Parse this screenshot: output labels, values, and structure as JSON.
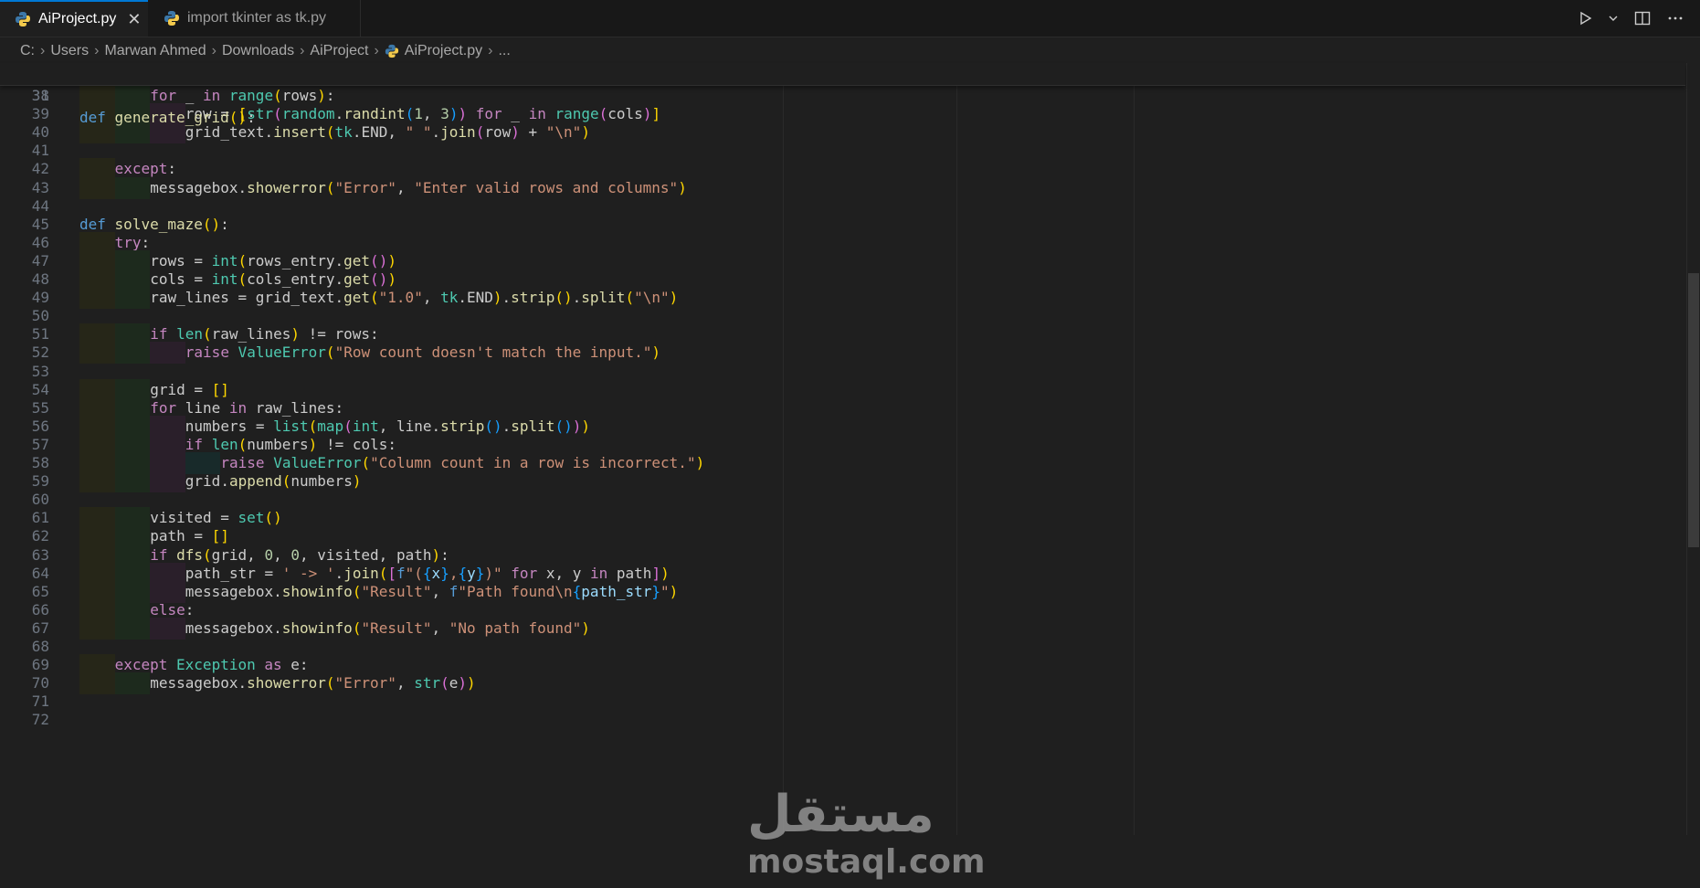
{
  "tabs": [
    {
      "label": "AiProject.py",
      "active": true
    },
    {
      "label": "import tkinter as tk.py",
      "active": false
    }
  ],
  "tab_close_glyph": "✕",
  "breadcrumb": [
    "C:",
    "Users",
    "Marwan Ahmed",
    "Downloads",
    "AiProject",
    "AiProject.py",
    "..."
  ],
  "sticky_line": {
    "num": "31",
    "code": "def generate_grid():"
  },
  "watermark": {
    "arabic": "مستقل",
    "latin": "mostaql.com"
  },
  "icons": {
    "run": "run-icon",
    "split": "split-editor-icon",
    "more": "more-actions-icon",
    "python": "python-file-icon"
  },
  "colors": {
    "keyword": "#c586c0",
    "def": "#569cd6",
    "function": "#dcdcaa",
    "string": "#ce9178",
    "number": "#b5cea8",
    "type": "#4ec9b0",
    "accent": "#0078d4"
  },
  "lines": [
    {
      "num": "38",
      "indent": 2,
      "code": "for _ in range(rows):"
    },
    {
      "num": "39",
      "indent": 3,
      "code": "row = [str(random.randint(1, 3)) for _ in range(cols)]"
    },
    {
      "num": "40",
      "indent": 3,
      "code": "grid_text.insert(tk.END, \" \".join(row) + \"\\n\")"
    },
    {
      "num": "41",
      "indent": 0,
      "code": ""
    },
    {
      "num": "42",
      "indent": 1,
      "code": "except:"
    },
    {
      "num": "43",
      "indent": 2,
      "code": "messagebox.showerror(\"Error\", \"Enter valid rows and columns\")"
    },
    {
      "num": "44",
      "indent": 0,
      "code": ""
    },
    {
      "num": "45",
      "indent": 0,
      "code": "def solve_maze():"
    },
    {
      "num": "46",
      "indent": 1,
      "code": "try:"
    },
    {
      "num": "47",
      "indent": 2,
      "code": "rows = int(rows_entry.get())"
    },
    {
      "num": "48",
      "indent": 2,
      "code": "cols = int(cols_entry.get())"
    },
    {
      "num": "49",
      "indent": 2,
      "code": "raw_lines = grid_text.get(\"1.0\", tk.END).strip().split(\"\\n\")"
    },
    {
      "num": "50",
      "indent": 0,
      "code": ""
    },
    {
      "num": "51",
      "indent": 2,
      "code": "if len(raw_lines) != rows:"
    },
    {
      "num": "52",
      "indent": 3,
      "code": "raise ValueError(\"Row count doesn't match the input.\")"
    },
    {
      "num": "53",
      "indent": 0,
      "code": ""
    },
    {
      "num": "54",
      "indent": 2,
      "code": "grid = []"
    },
    {
      "num": "55",
      "indent": 2,
      "code": "for line in raw_lines:"
    },
    {
      "num": "56",
      "indent": 3,
      "code": "numbers = list(map(int, line.strip().split()))"
    },
    {
      "num": "57",
      "indent": 3,
      "code": "if len(numbers) != cols:"
    },
    {
      "num": "58",
      "indent": 4,
      "code": "raise ValueError(\"Column count in a row is incorrect.\")"
    },
    {
      "num": "59",
      "indent": 3,
      "code": "grid.append(numbers)"
    },
    {
      "num": "60",
      "indent": 0,
      "code": ""
    },
    {
      "num": "61",
      "indent": 2,
      "code": "visited = set()"
    },
    {
      "num": "62",
      "indent": 2,
      "code": "path = []"
    },
    {
      "num": "63",
      "indent": 2,
      "code": "if dfs(grid, 0, 0, visited, path):"
    },
    {
      "num": "64",
      "indent": 3,
      "code": "path_str = ' -> '.join([f\"({x},{y})\" for x, y in path])"
    },
    {
      "num": "65",
      "indent": 3,
      "code": "messagebox.showinfo(\"Result\", f\"Path found\\n{path_str}\")"
    },
    {
      "num": "66",
      "indent": 2,
      "code": "else:"
    },
    {
      "num": "67",
      "indent": 3,
      "code": "messagebox.showinfo(\"Result\", \"No path found\")"
    },
    {
      "num": "68",
      "indent": 0,
      "code": ""
    },
    {
      "num": "69",
      "indent": 1,
      "code": "except Exception as e:"
    },
    {
      "num": "70",
      "indent": 2,
      "code": "messagebox.showerror(\"Error\", str(e))"
    },
    {
      "num": "71",
      "indent": 0,
      "code": ""
    },
    {
      "num": "72",
      "indent": 0,
      "code": ""
    }
  ]
}
